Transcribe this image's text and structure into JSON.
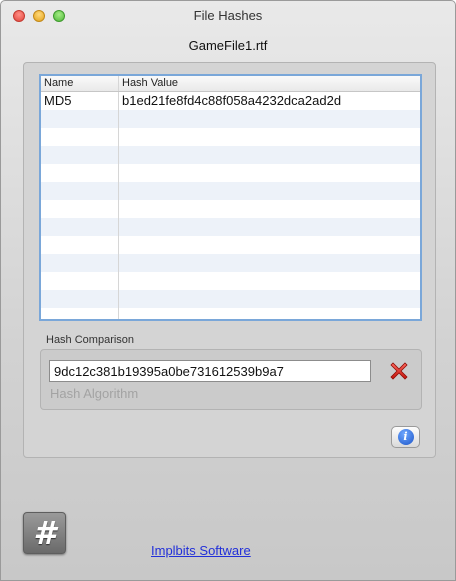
{
  "window": {
    "title": "File Hashes",
    "file_name": "GameFile1.rtf"
  },
  "table": {
    "columns": [
      "Name",
      "Hash Value"
    ],
    "rows": [
      {
        "name": "MD5",
        "hash": "b1ed21fe8fd4c88f058a4232dca2ad2d"
      },
      {
        "name": "",
        "hash": ""
      },
      {
        "name": "",
        "hash": ""
      },
      {
        "name": "",
        "hash": ""
      },
      {
        "name": "",
        "hash": ""
      },
      {
        "name": "",
        "hash": ""
      },
      {
        "name": "",
        "hash": ""
      },
      {
        "name": "",
        "hash": ""
      },
      {
        "name": "",
        "hash": ""
      },
      {
        "name": "",
        "hash": ""
      },
      {
        "name": "",
        "hash": ""
      },
      {
        "name": "",
        "hash": ""
      },
      {
        "name": "",
        "hash": ""
      }
    ]
  },
  "comparison": {
    "group_label": "Hash Comparison",
    "input_value": "9dc12c381b19395a0be731612539b9a7",
    "algorithm_label": "Hash Algorithm"
  },
  "footer": {
    "link_text": "Implbits Software",
    "app_icon_glyph": "#"
  },
  "colors": {
    "accent_border": "#7aa7d9",
    "link": "#2230d9",
    "clear_red": "#e0261d"
  },
  "icons": [
    "close-icon",
    "minimize-icon",
    "zoom-icon",
    "clear-x-icon",
    "info-icon",
    "hash-app-icon"
  ]
}
